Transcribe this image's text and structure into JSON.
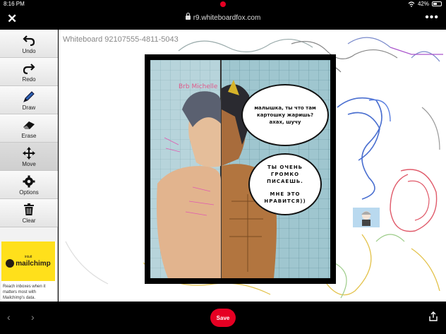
{
  "status_bar": {
    "time": "8:16 PM",
    "battery": "42%"
  },
  "browser": {
    "url": "r9.whiteboardfox.com"
  },
  "toolbar": {
    "undo": "Undo",
    "redo": "Redo",
    "draw": "Draw",
    "erase": "Erase",
    "move": "Move",
    "options": "Options",
    "clear": "Clear"
  },
  "ad": {
    "brand_small": "intuit",
    "brand_name": "mailchimp",
    "text": "Reach inboxes when it matters most with Mailchimp's data."
  },
  "whiteboard": {
    "title": "Whiteboard 92107555-4811-5043",
    "bubble_top": [
      "малышка, ты что там",
      "картошку жаришь?",
      "ахах, шучу"
    ],
    "bubble_bottom": [
      "ТЫ ОЧЕНЬ",
      "ГРОМКО",
      "ПИСАЕШЬ.",
      "МНЕ ЭТО",
      "НРАВИТСЯ))"
    ]
  },
  "bottom": {
    "save": "Save"
  },
  "colors": {
    "pinterest_red": "#e60023",
    "mailchimp_yellow": "#ffe01b"
  }
}
